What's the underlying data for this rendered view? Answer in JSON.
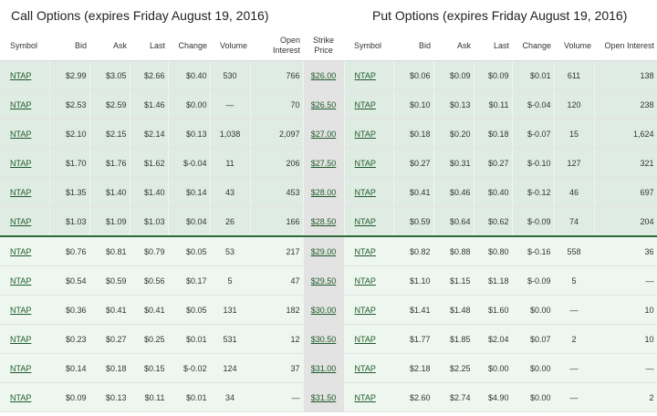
{
  "call_title": "Call Options (expires Friday August 19, 2016)",
  "put_title": "Put Options (expires Friday August 19, 2016)",
  "headers": {
    "symbol": "Symbol",
    "bid": "Bid",
    "ask": "Ask",
    "last": "Last",
    "change": "Change",
    "volume": "Volume",
    "open_interest": "Open Interest",
    "strike_price": "Strike Price"
  },
  "rows": [
    {
      "zone": "itm",
      "strike": "$26.00",
      "call": {
        "symbol": "NTAP",
        "bid": "$2.99",
        "ask": "$3.05",
        "last": "$2.66",
        "change": "$0.40",
        "volume": "530",
        "oi": "766"
      },
      "put": {
        "symbol": "NTAP",
        "bid": "$0.06",
        "ask": "$0.09",
        "last": "$0.09",
        "change": "$0.01",
        "volume": "611",
        "oi": "138"
      }
    },
    {
      "zone": "itm",
      "strike": "$26.50",
      "call": {
        "symbol": "NTAP",
        "bid": "$2.53",
        "ask": "$2.59",
        "last": "$1.46",
        "change": "$0.00",
        "volume": "—",
        "oi": "70"
      },
      "put": {
        "symbol": "NTAP",
        "bid": "$0.10",
        "ask": "$0.13",
        "last": "$0.11",
        "change": "$-0.04",
        "volume": "120",
        "oi": "238"
      }
    },
    {
      "zone": "itm",
      "strike": "$27.00",
      "call": {
        "symbol": "NTAP",
        "bid": "$2.10",
        "ask": "$2.15",
        "last": "$2.14",
        "change": "$0.13",
        "volume": "1,038",
        "oi": "2,097"
      },
      "put": {
        "symbol": "NTAP",
        "bid": "$0.18",
        "ask": "$0.20",
        "last": "$0.18",
        "change": "$-0.07",
        "volume": "15",
        "oi": "1,624"
      }
    },
    {
      "zone": "itm",
      "strike": "$27.50",
      "call": {
        "symbol": "NTAP",
        "bid": "$1.70",
        "ask": "$1.76",
        "last": "$1.62",
        "change": "$-0.04",
        "volume": "11",
        "oi": "206"
      },
      "put": {
        "symbol": "NTAP",
        "bid": "$0.27",
        "ask": "$0.31",
        "last": "$0.27",
        "change": "$-0.10",
        "volume": "127",
        "oi": "321"
      }
    },
    {
      "zone": "itm",
      "strike": "$28.00",
      "call": {
        "symbol": "NTAP",
        "bid": "$1.35",
        "ask": "$1.40",
        "last": "$1.40",
        "change": "$0.14",
        "volume": "43",
        "oi": "453"
      },
      "put": {
        "symbol": "NTAP",
        "bid": "$0.41",
        "ask": "$0.46",
        "last": "$0.40",
        "change": "$-0.12",
        "volume": "46",
        "oi": "697"
      }
    },
    {
      "zone": "itm",
      "strike": "$28.50",
      "call": {
        "symbol": "NTAP",
        "bid": "$1.03",
        "ask": "$1.09",
        "last": "$1.03",
        "change": "$0.04",
        "volume": "26",
        "oi": "166"
      },
      "put": {
        "symbol": "NTAP",
        "bid": "$0.59",
        "ask": "$0.64",
        "last": "$0.62",
        "change": "$-0.09",
        "volume": "74",
        "oi": "204"
      }
    },
    {
      "zone": "otm",
      "strike": "$29.00",
      "call": {
        "symbol": "NTAP",
        "bid": "$0.76",
        "ask": "$0.81",
        "last": "$0.79",
        "change": "$0.05",
        "volume": "53",
        "oi": "217"
      },
      "put": {
        "symbol": "NTAP",
        "bid": "$0.82",
        "ask": "$0.88",
        "last": "$0.80",
        "change": "$-0.16",
        "volume": "558",
        "oi": "36"
      }
    },
    {
      "zone": "otm",
      "strike": "$29.50",
      "call": {
        "symbol": "NTAP",
        "bid": "$0.54",
        "ask": "$0.59",
        "last": "$0.56",
        "change": "$0.17",
        "volume": "5",
        "oi": "47"
      },
      "put": {
        "symbol": "NTAP",
        "bid": "$1.10",
        "ask": "$1.15",
        "last": "$1.18",
        "change": "$-0.09",
        "volume": "5",
        "oi": "—"
      }
    },
    {
      "zone": "otm",
      "strike": "$30.00",
      "call": {
        "symbol": "NTAP",
        "bid": "$0.36",
        "ask": "$0.41",
        "last": "$0.41",
        "change": "$0.05",
        "volume": "131",
        "oi": "182"
      },
      "put": {
        "symbol": "NTAP",
        "bid": "$1.41",
        "ask": "$1.48",
        "last": "$1.60",
        "change": "$0.00",
        "volume": "—",
        "oi": "10"
      }
    },
    {
      "zone": "otm",
      "strike": "$30.50",
      "call": {
        "symbol": "NTAP",
        "bid": "$0.23",
        "ask": "$0.27",
        "last": "$0.25",
        "change": "$0.01",
        "volume": "531",
        "oi": "12"
      },
      "put": {
        "symbol": "NTAP",
        "bid": "$1.77",
        "ask": "$1.85",
        "last": "$2.04",
        "change": "$0.07",
        "volume": "2",
        "oi": "10"
      }
    },
    {
      "zone": "otm",
      "strike": "$31.00",
      "call": {
        "symbol": "NTAP",
        "bid": "$0.14",
        "ask": "$0.18",
        "last": "$0.15",
        "change": "$-0.02",
        "volume": "124",
        "oi": "37"
      },
      "put": {
        "symbol": "NTAP",
        "bid": "$2.18",
        "ask": "$2.25",
        "last": "$0.00",
        "change": "$0.00",
        "volume": "—",
        "oi": "—"
      }
    },
    {
      "zone": "otm",
      "strike": "$31.50",
      "call": {
        "symbol": "NTAP",
        "bid": "$0.09",
        "ask": "$0.13",
        "last": "$0.11",
        "change": "$0.01",
        "volume": "34",
        "oi": "—"
      },
      "put": {
        "symbol": "NTAP",
        "bid": "$2.60",
        "ask": "$2.74",
        "last": "$4.90",
        "change": "$0.00",
        "volume": "—",
        "oi": "2"
      }
    }
  ]
}
